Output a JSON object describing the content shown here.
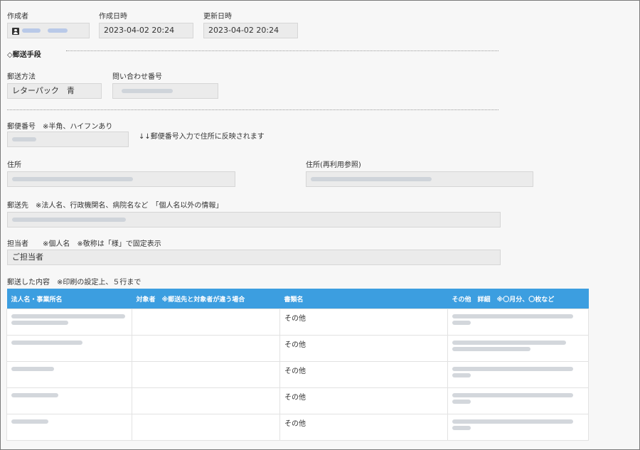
{
  "header": {
    "creator_label": "作成者",
    "created_label": "作成日時",
    "created_value": "2023-04-02 20:24",
    "updated_label": "更新日時",
    "updated_value": "2023-04-02 20:24"
  },
  "section": {
    "title": "◇郵送手段"
  },
  "shipping": {
    "method_label": "郵送方法",
    "method_value": "レターパック　青",
    "inquiry_label": "問い合わせ番号"
  },
  "postal": {
    "label": "郵便番号　※半角、ハイフンあり",
    "hint": "↓↓郵便番号入力で住所に反映されます"
  },
  "address": {
    "label": "住所",
    "reuse_label": "住所(再利用参照)"
  },
  "recipient": {
    "label": "郵送先　※法人名、行政機関名、病院名など　「個人名以外の情報」"
  },
  "contact": {
    "label": "担当者　　※個人名　※敬称は「様」で固定表示",
    "value": "ご担当者"
  },
  "contents": {
    "label": "郵送した内容　※印刷の設定上、５行まで",
    "columns": [
      "法人名・事業所名",
      "対象者　※郵送先と対象者が違う場合",
      "書類名",
      "その他　詳細　※〇月分、〇枚など"
    ],
    "rows": [
      {
        "doc": "その他"
      },
      {
        "doc": "その他"
      },
      {
        "doc": "その他"
      },
      {
        "doc": "その他"
      },
      {
        "doc": "その他"
      }
    ]
  }
}
